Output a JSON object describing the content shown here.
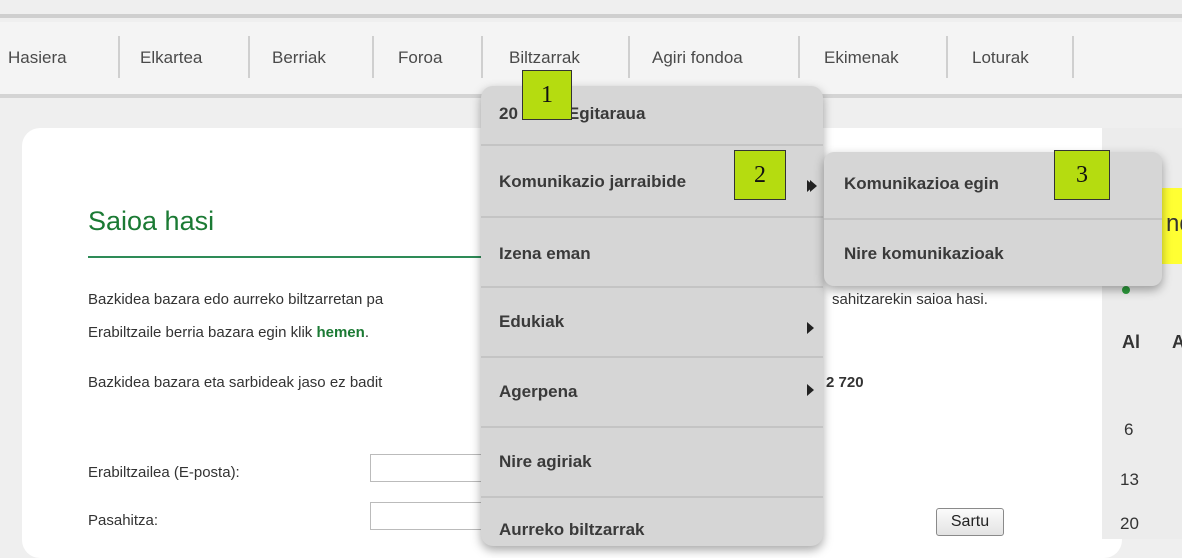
{
  "nav": {
    "items": [
      "Hasiera",
      "Elkartea",
      "Berriak",
      "Foroa",
      "Biltzarrak",
      "Agiri fondoa",
      "Ekimenak",
      "Loturak"
    ]
  },
  "login": {
    "title": "Saioa hasi",
    "intro_line1": "Bazkidea bazara edo aurreko biltzarretan pa",
    "intro_line1_end": "sahitzarekin saioa hasi.",
    "intro_line2_prefix": "Erabiltzaile berria bazara egin klik ",
    "intro_line2_link": "hemen",
    "intro_line2_suffix": ".",
    "info_line": "Bazkidea bazara eta sarbideak jaso ez badit",
    "info_line_end": "2 720",
    "user_label": "Erabiltzailea (E-posta):",
    "user_value": "",
    "password_label": "Pasahitza:",
    "password_value": "",
    "submit_label": "Sartu"
  },
  "dropdown": {
    "items": [
      "20",
      "Egitaraua",
      "Komunikazio jarraibide",
      "Izena eman",
      "Edukiak",
      "Agerpena",
      "Nire agiriak",
      "Aurreko biltzarrak"
    ]
  },
  "submenu": {
    "items": [
      "Komunikazioa egin",
      "Nire komunikazioak"
    ]
  },
  "side": {
    "partial_text": "nd",
    "header": "Al",
    "header2": "A",
    "numbers": [
      "6",
      "13",
      "20"
    ]
  },
  "markers": [
    "1",
    "2",
    "3"
  ],
  "colors": {
    "accent_green": "#1b7a34",
    "marker_green": "#b5dc10",
    "highlight_yellow": "#ffff33",
    "menu_gray": "#d6d6d6"
  }
}
